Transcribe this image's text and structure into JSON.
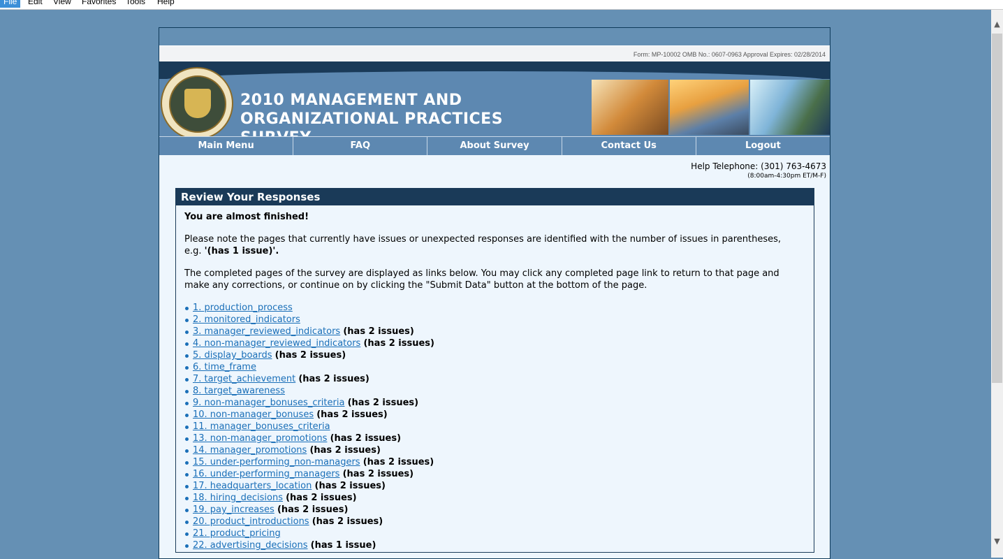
{
  "menu": [
    "File",
    "Edit",
    "View",
    "Favorites",
    "Tools",
    "Help"
  ],
  "form_info": "Form: MP-10002 OMB No.: 0607-0963 Approval Expires: 02/28/2014",
  "title_lines": [
    "2010 MANAGEMENT AND",
    "ORGANIZATIONAL PRACTICES",
    "SURVEY"
  ],
  "nav": [
    "Main Menu",
    "FAQ",
    "About Survey",
    "Contact Us",
    "Logout"
  ],
  "help": {
    "phone": "Help Telephone: (301) 763-4673",
    "hours": "(8:00am-4:30pm ET/M-F)"
  },
  "panel": {
    "heading": "Review Your Responses",
    "almost": "You are almost finished!",
    "note1": "Please note the pages that currently have issues or unexpected responses are identified with the number of issues in parentheses,",
    "note1_eg": "e.g. ",
    "note1_example": "'(has 1 issue)'.",
    "note2": "The completed pages of the survey are displayed as links below. You may click any completed page link to return to that page and make any corrections, or continue on by clicking the \"Submit Data\" button at the bottom of the page.",
    "items": [
      {
        "link": "1. production_process",
        "issue": ""
      },
      {
        "link": "2. monitored_indicators",
        "issue": ""
      },
      {
        "link": "3. manager_reviewed_indicators",
        "issue": "(has 2 issues)"
      },
      {
        "link": "4. non-manager_reviewed_indicators",
        "issue": "(has 2 issues)"
      },
      {
        "link": "5. display_boards",
        "issue": "(has 2 issues)"
      },
      {
        "link": "6. time_frame",
        "issue": ""
      },
      {
        "link": "7. target_achievement",
        "issue": "(has 2 issues)"
      },
      {
        "link": "8. target_awareness",
        "issue": ""
      },
      {
        "link": "9. non-manager_bonuses_criteria",
        "issue": "(has 2 issues)"
      },
      {
        "link": "10. non-manager_bonuses",
        "issue": "(has 2 issues)"
      },
      {
        "link": "11. manager_bonuses_criteria",
        "issue": ""
      },
      {
        "link": "13. non-manager_promotions",
        "issue": "(has 2 issues)"
      },
      {
        "link": "14. manager_promotions",
        "issue": "(has 2 issues)"
      },
      {
        "link": "15. under-performing_non-managers",
        "issue": "(has 2 issues)"
      },
      {
        "link": "16. under-performing_managers",
        "issue": "(has 2 issues)"
      },
      {
        "link": "17. headquarters_location",
        "issue": "(has 2 issues)"
      },
      {
        "link": "18. hiring_decisions",
        "issue": "(has 2 issues)"
      },
      {
        "link": "19. pay_increases",
        "issue": "(has 2 issues)"
      },
      {
        "link": "20. product_introductions",
        "issue": "(has 2 issues)"
      },
      {
        "link": "21. product_pricing",
        "issue": ""
      },
      {
        "link": "22. advertising_decisions",
        "issue": "(has 1 issue)"
      }
    ]
  }
}
